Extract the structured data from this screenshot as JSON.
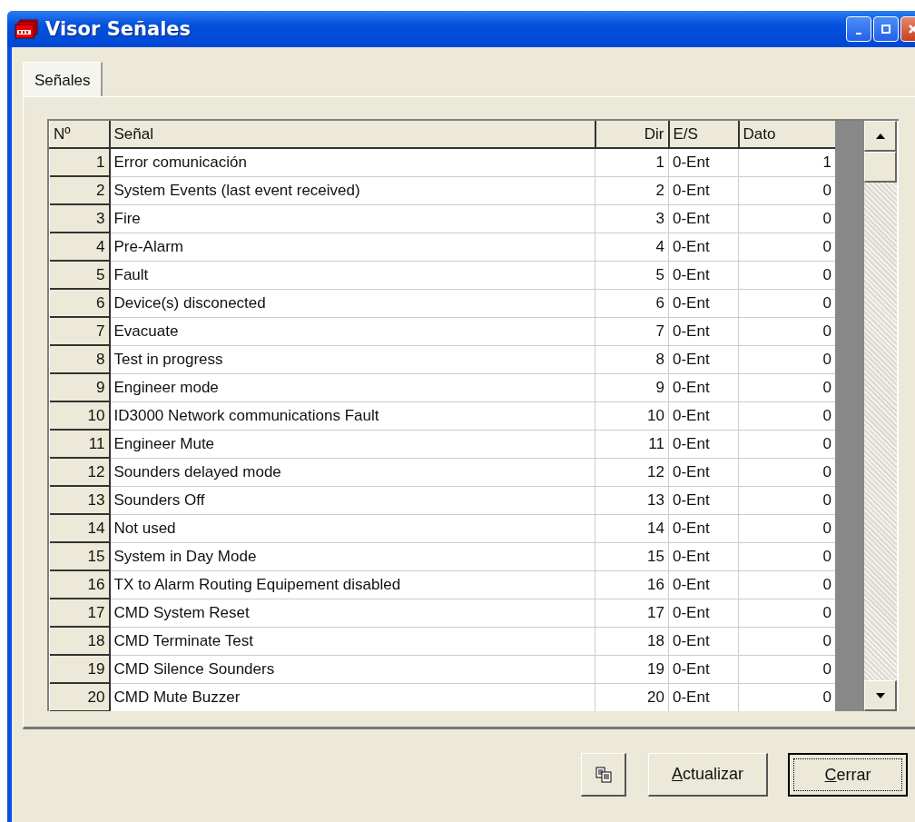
{
  "window": {
    "title": "Visor Señales"
  },
  "tabs": [
    {
      "label": "Señales",
      "selected": true
    }
  ],
  "table": {
    "columns": [
      "Nº",
      "Señal",
      "Dir",
      "E/S",
      "Dato"
    ],
    "rows": [
      [
        "1",
        "Error comunicación",
        "1",
        "0-Ent",
        "1"
      ],
      [
        "2",
        "System Events (last event received)",
        "2",
        "0-Ent",
        "0"
      ],
      [
        "3",
        "Fire",
        "3",
        "0-Ent",
        "0"
      ],
      [
        "4",
        "Pre-Alarm",
        "4",
        "0-Ent",
        "0"
      ],
      [
        "5",
        "Fault",
        "5",
        "0-Ent",
        "0"
      ],
      [
        "6",
        "Device(s) disconected",
        "6",
        "0-Ent",
        "0"
      ],
      [
        "7",
        "Evacuate",
        "7",
        "0-Ent",
        "0"
      ],
      [
        "8",
        "Test in progress",
        "8",
        "0-Ent",
        "0"
      ],
      [
        "9",
        "Engineer mode",
        "9",
        "0-Ent",
        "0"
      ],
      [
        "10",
        "ID3000 Network communications Fault",
        "10",
        "0-Ent",
        "0"
      ],
      [
        "11",
        "Engineer Mute",
        "11",
        "0-Ent",
        "0"
      ],
      [
        "12",
        "Sounders delayed mode",
        "12",
        "0-Ent",
        "0"
      ],
      [
        "13",
        "Sounders Off",
        "13",
        "0-Ent",
        "0"
      ],
      [
        "14",
        "Not used",
        "14",
        "0-Ent",
        "0"
      ],
      [
        "15",
        "System in Day Mode",
        "15",
        "0-Ent",
        "0"
      ],
      [
        "16",
        "TX to Alarm Routing Equipement disabled",
        "16",
        "0-Ent",
        "0"
      ],
      [
        "17",
        "CMD System Reset",
        "17",
        "0-Ent",
        "0"
      ],
      [
        "18",
        "CMD Terminate Test",
        "18",
        "0-Ent",
        "0"
      ],
      [
        "19",
        "CMD Silence Sounders",
        "19",
        "0-Ent",
        "0"
      ],
      [
        "20",
        "CMD Mute Buzzer",
        "20",
        "0-Ent",
        "0"
      ]
    ]
  },
  "buttons": [
    {
      "kind": "icon"
    },
    {
      "kind": "text",
      "label": "Actualizar",
      "default": false
    },
    {
      "kind": "text",
      "label": "Cerrar",
      "default": true
    }
  ]
}
